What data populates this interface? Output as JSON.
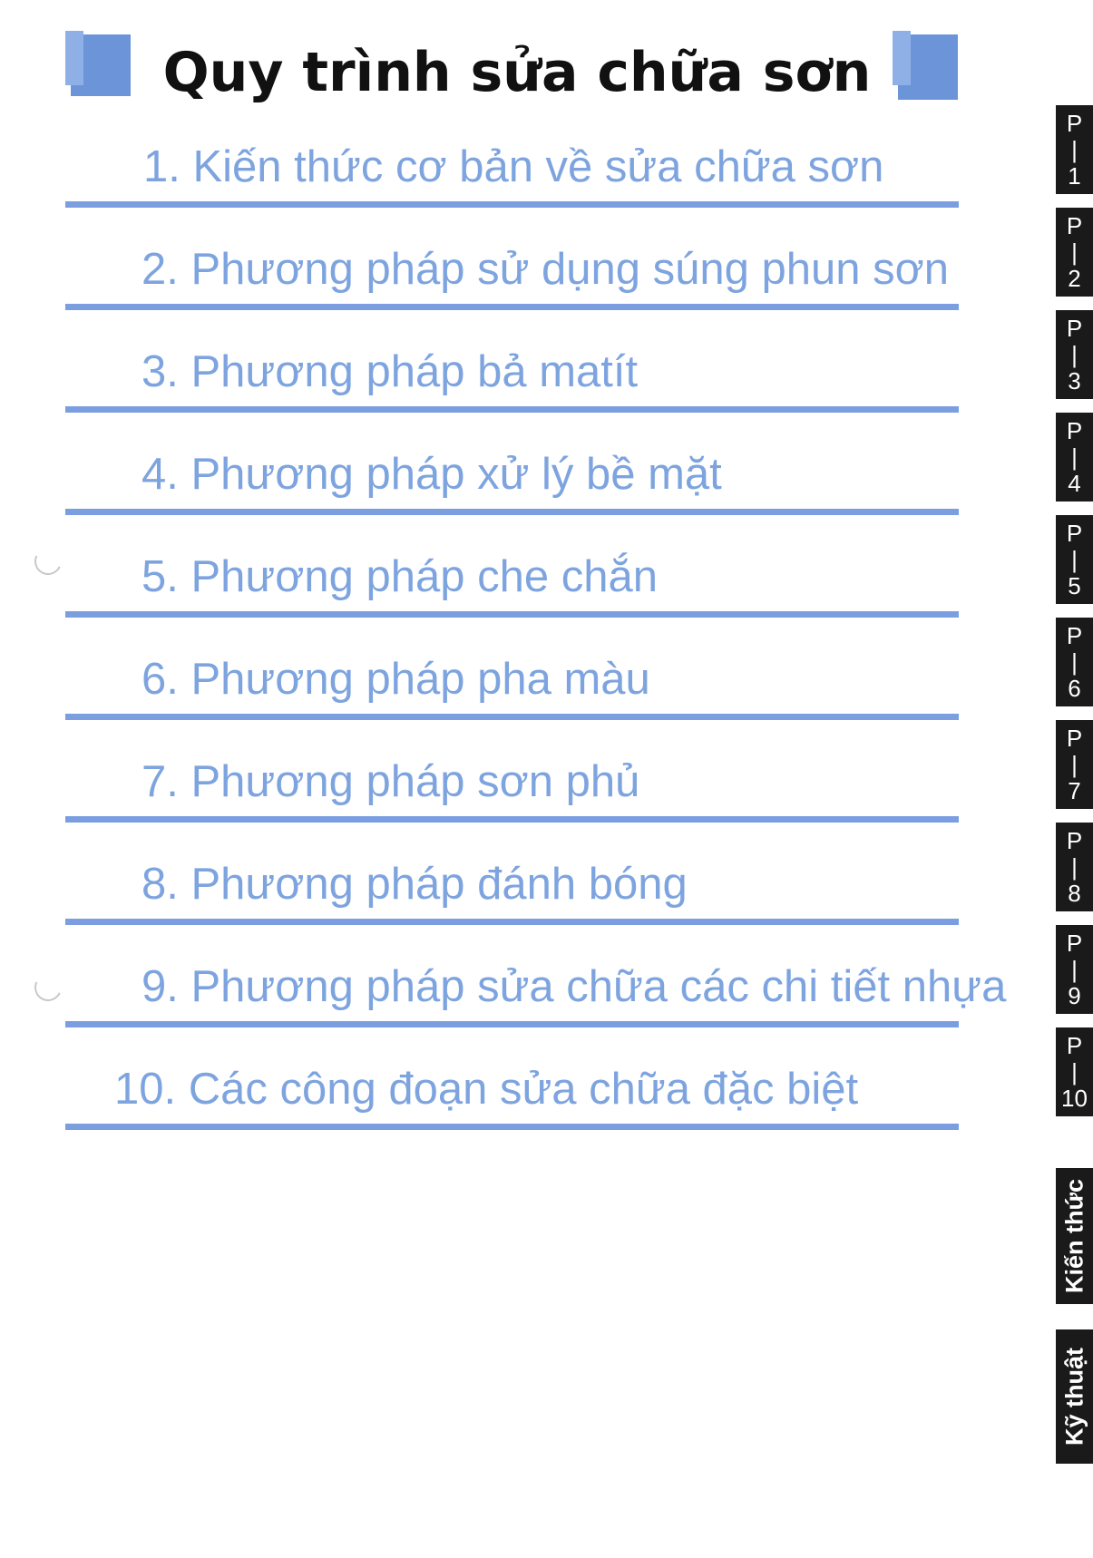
{
  "title": "Quy trình sửa chữa sơn",
  "menu": [
    {
      "label": "1. Kiến thức cơ bản về sửa chữa sơn"
    },
    {
      "label": "2. Phương pháp sử dụng súng phun sơn"
    },
    {
      "label": "3. Phương pháp bả matít"
    },
    {
      "label": "4. Phương pháp xử lý bề mặt"
    },
    {
      "label": "5. Phương pháp che chắn"
    },
    {
      "label": "6. Phương pháp pha màu"
    },
    {
      "label": "7. Phương pháp sơn phủ"
    },
    {
      "label": "8. Phương pháp đánh bóng"
    },
    {
      "label": "9. Phương pháp sửa chữa các chi tiết nhựa"
    },
    {
      "label": "10. Các công đoạn sửa chữa đặc biệt"
    }
  ],
  "side_tabs": [
    {
      "label": "P\n|\n1"
    },
    {
      "label": "P\n|\n2"
    },
    {
      "label": "P\n|\n3"
    },
    {
      "label": "P\n|\n4"
    },
    {
      "label": "P\n|\n5"
    },
    {
      "label": "P\n|\n6"
    },
    {
      "label": "P\n|\n7"
    },
    {
      "label": "P\n|\n8"
    },
    {
      "label": "P\n|\n9"
    },
    {
      "label": "P\n|\n10"
    }
  ],
  "vertical_tabs": [
    {
      "label": "Kiến thức"
    },
    {
      "label": "Kỹ thuật"
    }
  ],
  "colors": {
    "accent": "#7a9ee0",
    "item_text": "#7ea4df",
    "title_text": "#111111",
    "tab_bg": "#1a1a1a"
  }
}
